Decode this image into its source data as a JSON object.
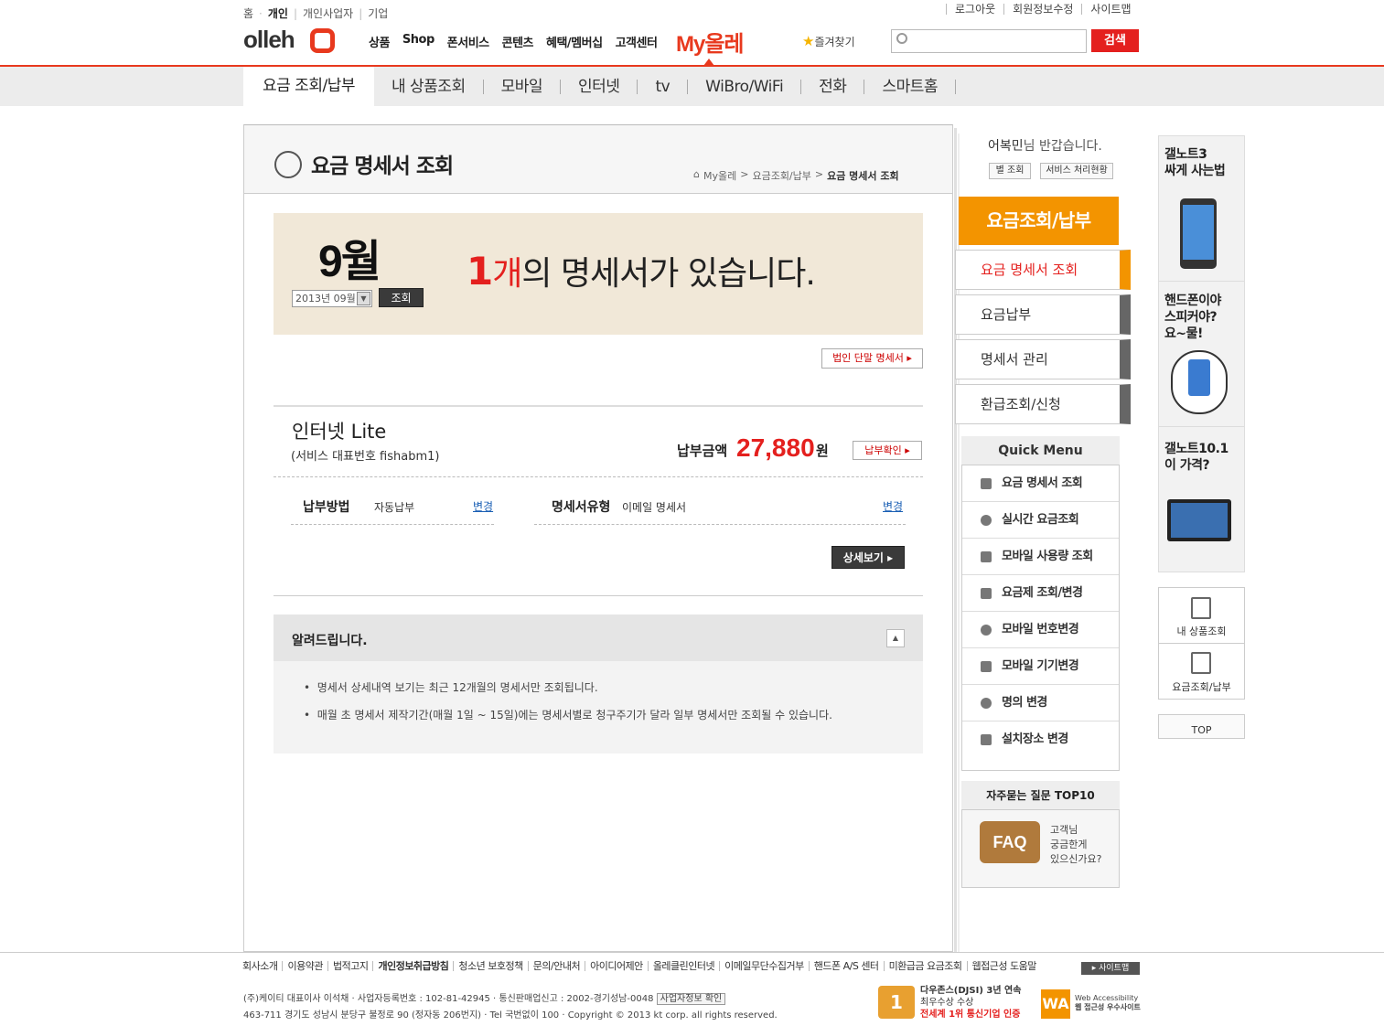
{
  "util_nav": {
    "home": "홈",
    "personal": "개인",
    "sole": "개인사업자",
    "corp": "기업"
  },
  "util_right": [
    "로그아웃",
    "회원정보수정",
    "사이트맵"
  ],
  "logo": "olleh",
  "gnb": [
    "상품",
    "Shop",
    "폰서비스",
    "콘텐츠",
    "혜택/멤버십",
    "고객센터"
  ],
  "myolleh": "My올레",
  "favorites": "즐겨찾기",
  "search": {
    "button": "검색",
    "placeholder": ""
  },
  "tabs": [
    "요금 조회/납부",
    "내 상품조회",
    "모바일",
    "인터넷",
    "tv",
    "WiBro/WiFi",
    "전화",
    "스마트홈"
  ],
  "page": {
    "title": "요금 명세서 조회",
    "breadcrumb": [
      "My올레",
      "요금조회/납부",
      "요금 명세서 조회"
    ],
    "breadcrumb_sep": ">"
  },
  "month_panel": {
    "month": "9월",
    "selected": "2013년 09월",
    "lookup": "조회",
    "count": "1",
    "unit": "개",
    "msg": "의 명세서가 있습니다."
  },
  "corp_button": "법인 단말 명세서",
  "service": {
    "name": "인터넷 Lite",
    "sub": "(서비스 대표번호 fishabm1)",
    "pay_label": "납부금액",
    "amount": "27,880",
    "currency": "원",
    "paycheck": "납부확인",
    "method_label": "납부방법",
    "method_value": "자동납부",
    "change": "변경",
    "type_label": "명세서유형",
    "type_value": "이메일 명세서",
    "detail": "상세보기"
  },
  "notice": {
    "title": "알려드립니다.",
    "toggle": "▲",
    "items": [
      "명세서 상세내역 보기는 최근 12개월의 명세서만 조회됩니다.",
      "매월 초 명세서 제작기간(매월 1일 ~ 15일)에는 명세서별로 청구주기가 달라 일부 명세서만 조회될 수 있습니다."
    ]
  },
  "greeting": {
    "name": "어복민",
    "suffix": "님 반갑습니다.",
    "btn1": "별 조회",
    "btn2": "서비스 처리현황"
  },
  "side": {
    "head": "요금조회/납부",
    "items": [
      "요금 명세서 조회",
      "요금납부",
      "명세서 관리",
      "환급조회/신청"
    ]
  },
  "quick": {
    "head": "Quick Menu",
    "items": [
      "요금 명세서 조회",
      "실시간 요금조회",
      "모바일 사용량 조회",
      "요금제 조회/변경",
      "모바일 번호변경",
      "모바일 기기변경",
      "명의 변경",
      "설치장소 변경"
    ]
  },
  "faq": {
    "head": "자주묻는 질문 TOP10",
    "badge": "FAQ",
    "line1": "고객님",
    "line2": "궁금한게",
    "line3": "있으신가요?"
  },
  "banners": [
    {
      "l1": "갤노트3",
      "l2": "싸게 사는법"
    },
    {
      "l1": "핸드폰이야",
      "l2": "스피커야?",
      "l3": "요~물!"
    },
    {
      "l1": "갤노트10.1",
      "l2": "이 가격?"
    }
  ],
  "quickbox": [
    "내 상품조회",
    "요금조회/납부"
  ],
  "top": "TOP",
  "footer": {
    "links": [
      "회사소개",
      "이용약관",
      "법적고지",
      "개인정보취급방침",
      "청소년 보호정책",
      "문의/안내처",
      "아이디어제안",
      "올레클린인터넷",
      "이메일무단수집거부",
      "핸드폰 A/S 센터",
      "미환급금 요금조회",
      "웹접근성 도움말"
    ],
    "sitemap": "사이트맵",
    "line1": "(주)케이티 대표이사 이석채 · 사업자등록번호 : 102-81-42945 · 통신판매업신고 : 2002-경기성남-0048",
    "biz_btn": "사업자정보 확인",
    "line2": "463-711 경기도 성남시 분당구 불정로 90 (정자동 206번지) · Tel 국번없이 100 · Copyright © 2013 kt corp. all rights reserved.",
    "award1_l1": "다우존스(DJSI) 3년 연속",
    "award1_l2": "최우수상 수상",
    "award1_l3": "전세계 1위 통신기업 인증",
    "award1_badge": "1",
    "award2_badge": "WA",
    "award2_l1": "Web Accessibility",
    "award2_l2": "웹 접근성 우수사이트"
  }
}
